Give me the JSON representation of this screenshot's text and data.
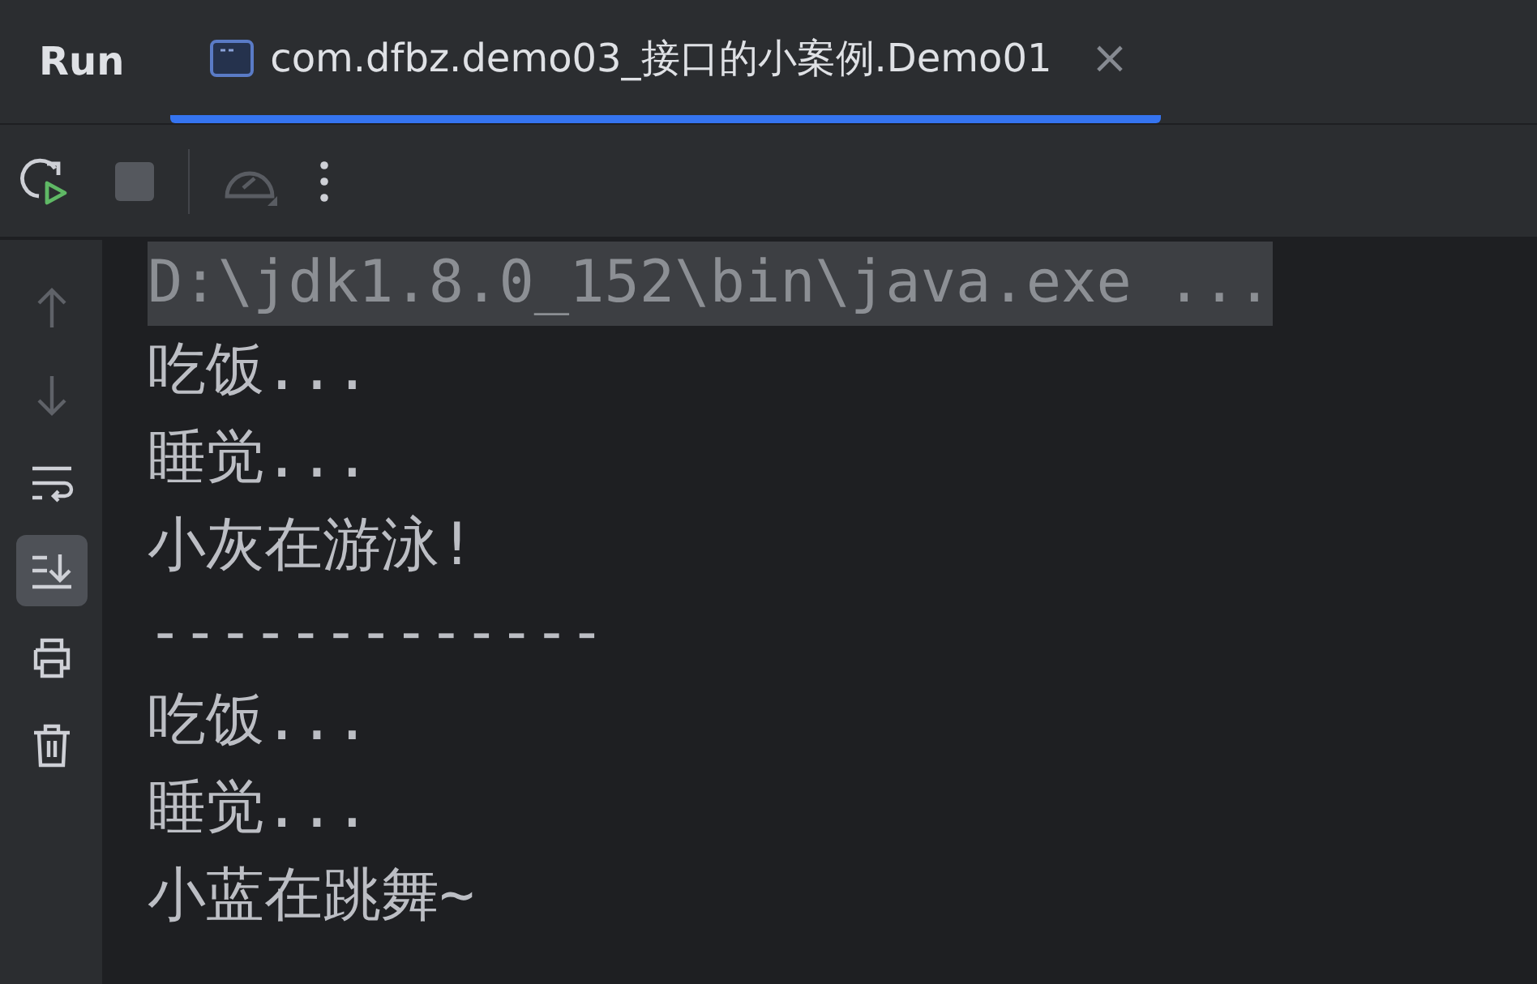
{
  "panel": {
    "title": "Run"
  },
  "tabs": [
    {
      "label": "com.dfbz.demo03_接口的小案例.Demo01",
      "selected": true,
      "close": "×"
    }
  ],
  "toolbar": [
    {
      "kind": "rerun",
      "disabled": false
    },
    {
      "kind": "stop",
      "disabled": true
    },
    {
      "kind": "profiler",
      "disabled": true
    },
    {
      "kind": "more",
      "disabled": false
    }
  ],
  "side_tools": [
    {
      "kind": "up",
      "disabled": true,
      "selected": false
    },
    {
      "kind": "down",
      "disabled": true,
      "selected": false
    },
    {
      "kind": "wrap",
      "disabled": false,
      "selected": false
    },
    {
      "kind": "scroll",
      "disabled": false,
      "selected": true
    },
    {
      "kind": "print",
      "disabled": false,
      "selected": false
    },
    {
      "kind": "delete",
      "disabled": false,
      "selected": false
    }
  ],
  "console_lines": [
    {
      "kind": "command",
      "text": "D:\\jdk1.8.0_152\\bin\\java.exe ..."
    },
    {
      "kind": "output",
      "text": "吃饭..."
    },
    {
      "kind": "output",
      "text": "睡觉..."
    },
    {
      "kind": "output",
      "text": "小灰在游泳!"
    },
    {
      "kind": "output",
      "text": "-------------"
    },
    {
      "kind": "output",
      "text": "吃饭..."
    },
    {
      "kind": "output",
      "text": "睡觉..."
    },
    {
      "kind": "output",
      "text": "小蓝在跳舞~"
    }
  ]
}
